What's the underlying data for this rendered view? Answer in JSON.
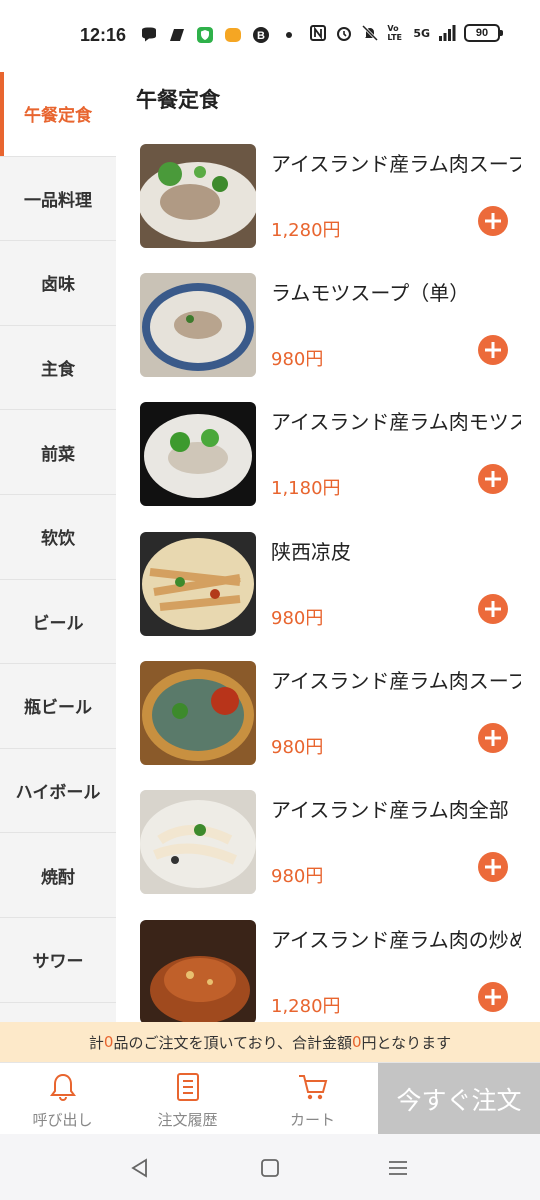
{
  "status_bar": {
    "time": "12:16",
    "battery": "90",
    "network_label": "5G",
    "volte_label": "Vo LTE"
  },
  "sidebar": {
    "categories": [
      {
        "label": "午餐定食",
        "active": true
      },
      {
        "label": "一品料理"
      },
      {
        "label": "卤味"
      },
      {
        "label": "主食"
      },
      {
        "label": "前菜"
      },
      {
        "label": "软饮"
      },
      {
        "label": "ビール"
      },
      {
        "label": "瓶ビール"
      },
      {
        "label": "ハイボール"
      },
      {
        "label": "焼酎"
      },
      {
        "label": "サワー"
      }
    ]
  },
  "main": {
    "section_title": "午餐定食",
    "items": [
      {
        "name": "アイスランド産ラム肉スープ",
        "price": "1,280円",
        "image": "lamb-soup-photo"
      },
      {
        "name": "ラムモツスープ（单）",
        "price": "980円",
        "image": "lamb-offal-soup-photo"
      },
      {
        "name": "アイスランド産ラム肉モツスープ",
        "price": "1,180円",
        "image": "lamb-mixed-soup-photo"
      },
      {
        "name": "陕西凉皮",
        "price": "980円",
        "image": "cold-noodles-photo"
      },
      {
        "name": "アイスランド産ラム肉スープ",
        "price": "980円",
        "image": "spicy-lamb-soup-photo"
      },
      {
        "name": "アイスランド産ラム肉全部",
        "price": "980円",
        "image": "lamb-noodle-soup-photo"
      },
      {
        "name": "アイスランド産ラム肉の炒め",
        "price": "1,280円",
        "image": "braised-meat-photo"
      }
    ]
  },
  "summary": {
    "prefix": "計",
    "count": "0",
    "middle": "品のご注文を頂いており、合計金額",
    "amount": "0",
    "suffix": "円となります"
  },
  "bottom_nav": {
    "call_label": "呼び出し",
    "history_label": "注文履歴",
    "cart_label": "カート",
    "order_now_label": "今すぐ注文"
  },
  "colors": {
    "accent": "#e8652f",
    "summary_bg": "#fde9c9",
    "order_btn_bg": "#c4c4c4",
    "sidebar_bg": "#f4f4f4"
  }
}
